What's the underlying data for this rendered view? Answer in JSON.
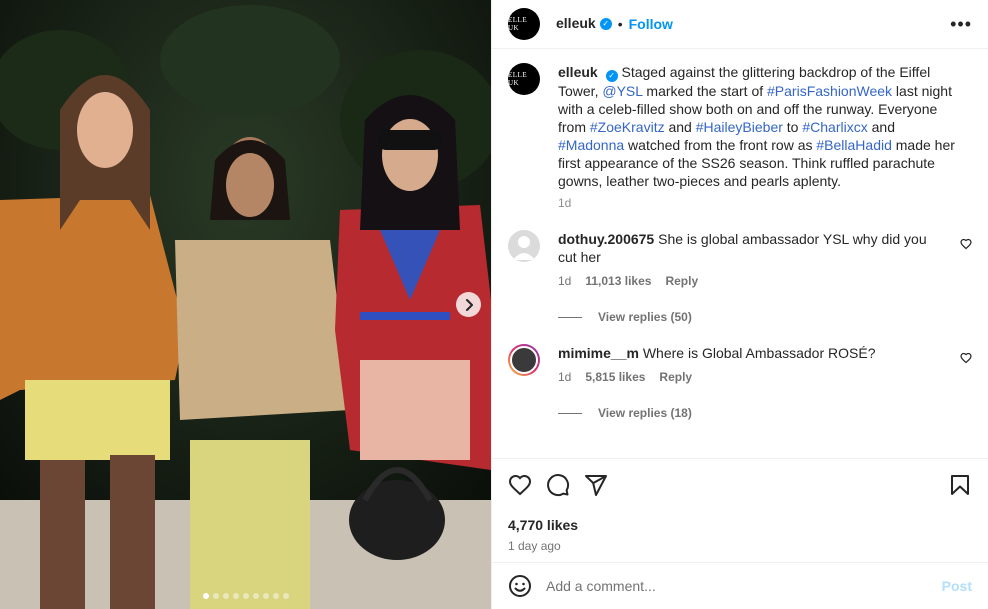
{
  "post": {
    "account": "elleuk",
    "avatar_text": "ELLE UK",
    "follow_label": "Follow",
    "separator": "•",
    "caption": {
      "segments": [
        {
          "text": "Staged against the glittering backdrop of the Eiffel Tower, "
        },
        {
          "text": "@YSL",
          "link": true
        },
        {
          "text": " marked the start of "
        },
        {
          "text": "#ParisFashionWeek",
          "link": true
        },
        {
          "text": " last night with a celeb-filled show both on and off the runway. Everyone from "
        },
        {
          "text": "#ZoeKravitz",
          "link": true
        },
        {
          "text": " and "
        },
        {
          "text": "#HaileyBieber",
          "link": true
        },
        {
          "text": " to "
        },
        {
          "text": "#Charlixcx",
          "link": true
        },
        {
          "text": " and "
        },
        {
          "text": "#Madonna",
          "link": true
        },
        {
          "text": " watched from the front row as "
        },
        {
          "text": "#BellaHadid",
          "link": true
        },
        {
          "text": " made her first appearance of the SS26 season. Think ruffled parachute gowns, leather two-pieces and pearls aplenty."
        }
      ],
      "time": "1d"
    },
    "comments": [
      {
        "user": "dothuy.200675",
        "text": "She is global ambassador YSL why did you cut her",
        "time": "1d",
        "likes": "11,013 likes",
        "reply": "Reply",
        "view_replies": "View replies (50)"
      },
      {
        "user": "mimime__m",
        "text": "Where is Global Ambassador ROSÉ?",
        "time": "1d",
        "likes": "5,815 likes",
        "reply": "Reply",
        "view_replies": "View replies (18)"
      }
    ],
    "likes_total": "4,770 likes",
    "posted_ago": "1 day ago",
    "comment_input_placeholder": "Add a comment...",
    "post_button": "Post",
    "carousel": {
      "dots": 9,
      "active_index": 0
    }
  },
  "icons": {
    "verified": "verified-badge-icon",
    "more": "more-options-icon",
    "like": "heart-icon",
    "comment": "comment-icon",
    "share": "share-icon",
    "save": "bookmark-icon",
    "emoji": "emoji-icon",
    "next": "chevron-right-icon"
  },
  "colors": {
    "accent": "#0095f6",
    "hashtag": "#3566c7",
    "muted": "#737373",
    "post_disabled": "#b2dffc"
  }
}
